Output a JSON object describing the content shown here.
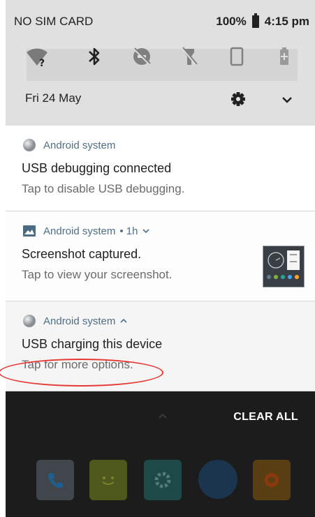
{
  "status_bar": {
    "carrier": "NO SIM CARD",
    "battery_percent": "100%",
    "time": "4:15 pm"
  },
  "quick_settings": {
    "tiles": [
      "wifi-unknown-icon",
      "bluetooth-icon",
      "do-not-disturb-off-icon",
      "flashlight-off-icon",
      "auto-rotate-icon",
      "battery-saver-icon"
    ],
    "date": "Fri 24 May"
  },
  "notifications": [
    {
      "app": "Android system",
      "meta": "",
      "title": "USB debugging connected",
      "text": "Tap to disable USB debugging."
    },
    {
      "app": "Android system",
      "meta": "• 1h",
      "title": "Screenshot captured.",
      "text": "Tap to view your screenshot."
    },
    {
      "app": "Android system",
      "meta": "",
      "title": "USB charging this device",
      "text": "Tap for more options."
    }
  ],
  "footer": {
    "clear_all": "CLEAR ALL"
  },
  "dock_apps": [
    "phone-app-icon",
    "messaging-app-icon",
    "settings-app-icon",
    "browser-app-icon",
    "camera-app-icon"
  ],
  "colors": {
    "header_bg": "#e0e0e0",
    "app_name": "#4e6f86",
    "annotation": "#e53935"
  }
}
